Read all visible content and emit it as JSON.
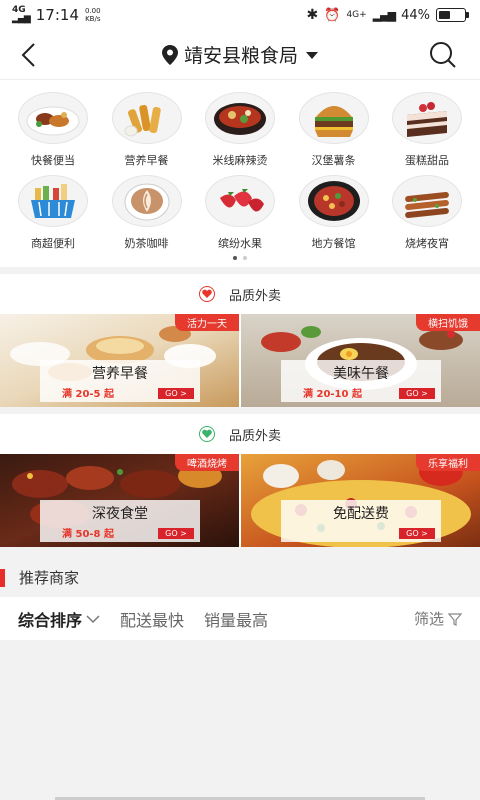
{
  "status_bar": {
    "network": "4G",
    "time": "17:14",
    "speed_value": "0.00",
    "speed_unit": "KB/s",
    "network_right": "4G+",
    "battery": "44%",
    "battery_level": 0.44
  },
  "header": {
    "location": "靖安县粮食局"
  },
  "categories": [
    {
      "label": "快餐便当",
      "icon": "fast-food"
    },
    {
      "label": "营养早餐",
      "icon": "breakfast"
    },
    {
      "label": "米线麻辣烫",
      "icon": "noodles-hotpot"
    },
    {
      "label": "汉堡薯条",
      "icon": "burger"
    },
    {
      "label": "蛋糕甜品",
      "icon": "cake"
    },
    {
      "label": "商超便利",
      "icon": "supermarket"
    },
    {
      "label": "奶茶咖啡",
      "icon": "coffee"
    },
    {
      "label": "缤纷水果",
      "icon": "fruit"
    },
    {
      "label": "地方餐馆",
      "icon": "local-restaurant"
    },
    {
      "label": "烧烤夜宵",
      "icon": "bbq"
    }
  ],
  "sections": [
    {
      "title": "品质外卖",
      "heart_color": "#e7362b",
      "banners": [
        {
          "tag": "活力一天",
          "title": "营养早餐",
          "sub": "满 20-5 起",
          "go": "GO >"
        },
        {
          "tag": "横扫饥饿",
          "title": "美味午餐",
          "sub": "满 20-10 起",
          "go": "GO >"
        }
      ]
    },
    {
      "title": "品质外卖",
      "heart_color": "#3bb36a",
      "banners": [
        {
          "tag": "啤酒烧烤",
          "title": "深夜食堂",
          "sub": "满 50-8 起",
          "go": "GO >"
        },
        {
          "tag": "乐享福利",
          "title": "免配送费",
          "sub": "",
          "go": "GO >"
        }
      ]
    }
  ],
  "recommend": {
    "title": "推荐商家"
  },
  "filters": {
    "sort": "综合排序",
    "fastest": "配送最快",
    "sales": "销量最高",
    "screen": "筛选"
  },
  "colors": {
    "accent": "#e62d2a",
    "tag": "#e63a2f"
  }
}
